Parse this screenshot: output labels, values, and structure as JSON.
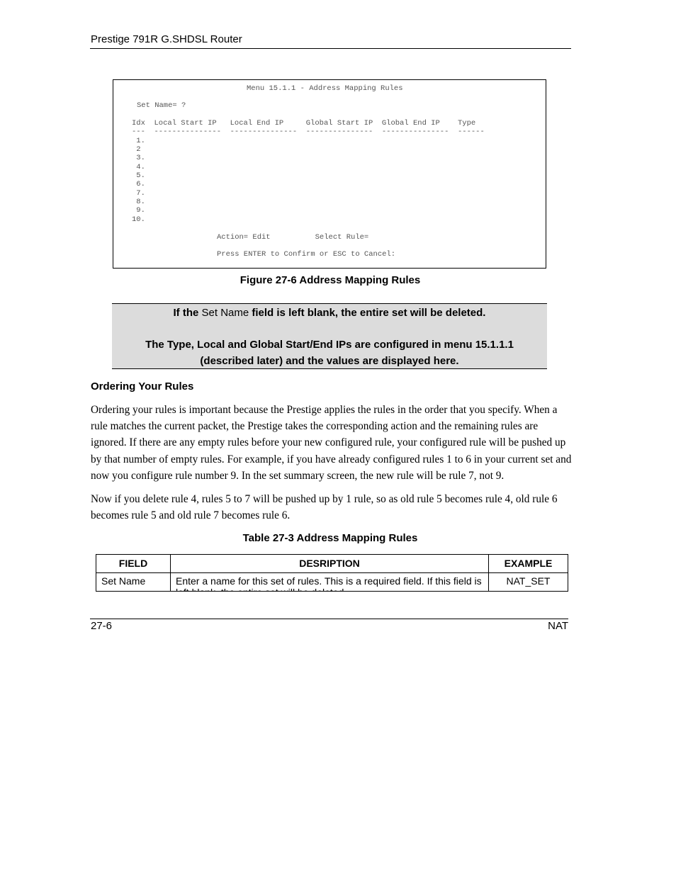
{
  "header": {
    "title": "Prestige 791R G.SHDSL Router"
  },
  "screen": {
    "menu_title": "Menu 15.1.1 - Address Mapping Rules",
    "set_name_line": "Set Name= ?",
    "column_header_line": "Idx  Local Start IP   Local End IP     Global Start IP  Global End IP    Type",
    "separator_line": "---  ---------------  ---------------  ---------------  ---------------  ------",
    "columns": [
      "Idx",
      "Local Start IP",
      "Local End IP",
      "Global Start IP",
      "Global End IP",
      "Type"
    ],
    "rows": [
      " 1.",
      " 2",
      " 3.",
      " 4.",
      " 5.",
      " 6.",
      " 7.",
      " 8.",
      " 9.",
      "10."
    ],
    "action_line": "Action= Edit          Select Rule=",
    "prompt_line": "Press ENTER to Confirm or ESC to Cancel:"
  },
  "figure_caption": "Figure 27-6 Address Mapping Rules",
  "note": {
    "line1_prefix": "If the ",
    "line1_field": "Set Name",
    "line1_suffix": " field is left blank, the entire set will be deleted.",
    "line2": "The Type, Local and Global Start/End IPs are configured in menu 15.1.1.1 (described later) and the values are displayed here."
  },
  "section": {
    "heading": "Ordering Your Rules",
    "paragraph1": "Ordering your rules is important because the Prestige applies the rules in the order that you specify. When a rule matches the current packet, the Prestige takes the corresponding action and the remaining rules are ignored. If there are any empty rules before your new configured rule, your configured rule will be pushed up by that number of empty rules. For example, if you have already configured rules 1 to 6 in your current set and now you configure rule number 9. In the set summary screen, the new rule will be rule 7, not 9.",
    "paragraph2": "Now if you delete rule 4, rules 5 to 7 will be pushed up by 1 rule, so as old rule 5 becomes rule 4, old rule 6 becomes rule 5 and old rule 7 becomes rule 6."
  },
  "table": {
    "caption": "Table 27-3 Address Mapping Rules",
    "headers": [
      "FIELD",
      "DESRIPTION",
      "EXAMPLE"
    ],
    "rows": [
      {
        "field": "Set Name",
        "description": "Enter a name for this set of rules. This is a required field. If this field is left blank, the entire set will be deleted.",
        "example": "NAT_SET"
      }
    ]
  },
  "footer": {
    "page_number": "27-6",
    "chapter": "NAT"
  }
}
